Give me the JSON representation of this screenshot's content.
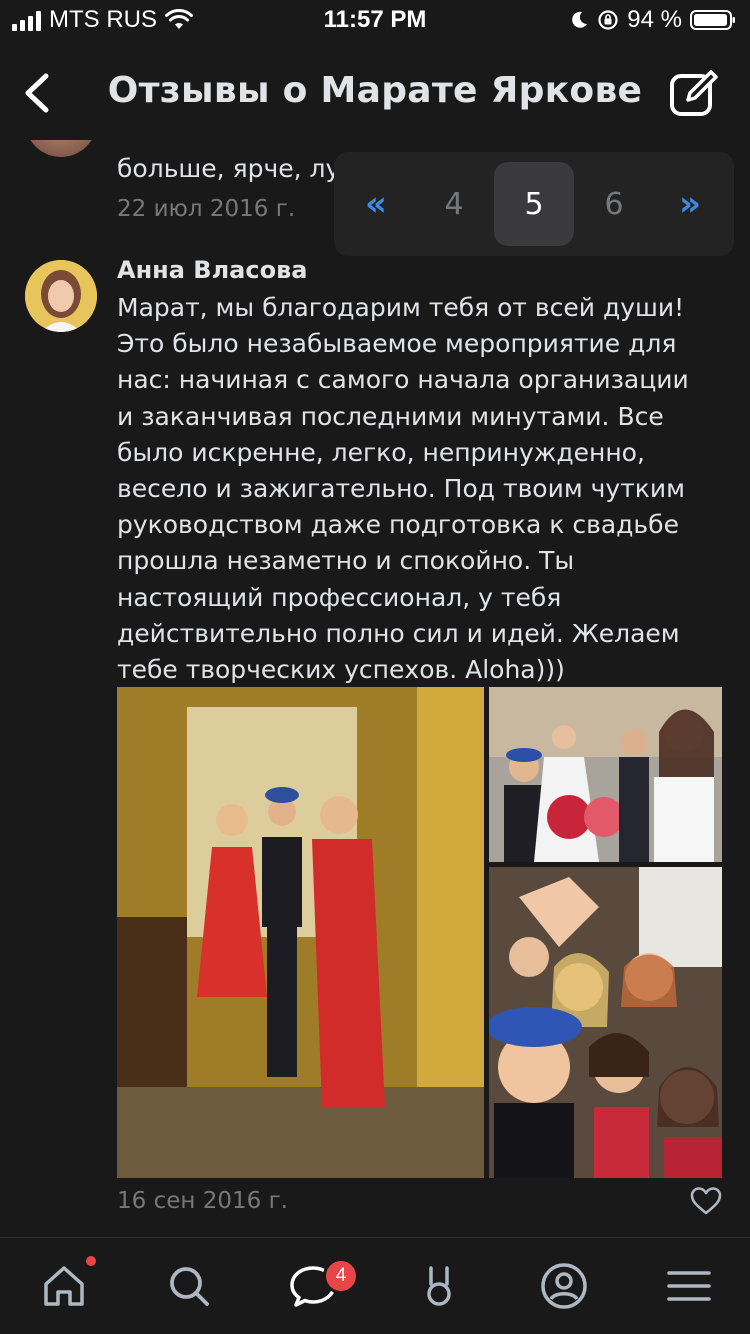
{
  "status_bar": {
    "carrier": "MTS RUS",
    "time": "11:57 PM",
    "battery": "94 %"
  },
  "header": {
    "title": "Отзывы о Марате Яркове",
    "back_icon": "chevron-left-icon",
    "edit_icon": "edit-icon"
  },
  "previous_review": {
    "text": "больше, ярче, лу",
    "date": "22 июл 2016 г."
  },
  "pagination": {
    "prev_label": "«",
    "pages": [
      "4",
      "5",
      "6"
    ],
    "current": "5",
    "next_label": "»"
  },
  "review": {
    "author": "Анна Власова",
    "text": "Марат, мы благодарим тебя от всей души!\nЭто было незабываемое мероприятие для\nнас: начиная с самого начала организации\nи заканчивая последними минутами. Все\nбыло искренне, легко, непринужденно,\nвесело и зажигательно. Под твоим чутким\nруководством даже подготовка к свадьбе\nпрошла незаметно и спокойно. Ты\nнастоящий профессионал, у тебя\nдействительно полно сил и идей. Желаем\nтебе творческих успехов. Aloha)))",
    "date": "16 сен 2016 г.",
    "like_icon": "heart-icon"
  },
  "tab_bar": {
    "items": [
      "home-icon",
      "search-icon",
      "messages-icon",
      "services-icon",
      "profile-icon",
      "menu-icon"
    ],
    "messages_badge": "4"
  },
  "colors": {
    "background": "#19191a",
    "accent": "#3f8ae0",
    "text": "#e1e3e6",
    "secondary": "#76787a",
    "badge": "#e64646"
  }
}
